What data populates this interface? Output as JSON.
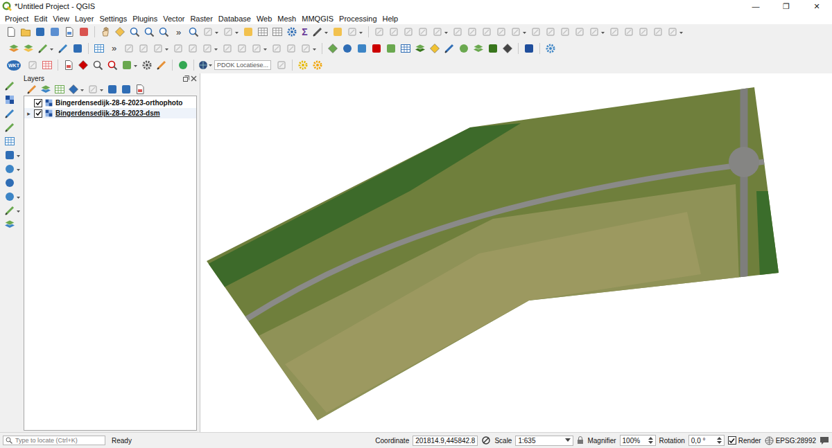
{
  "window": {
    "title": "*Untitled Project - QGIS",
    "controls": [
      "—",
      "❐",
      "✕"
    ]
  },
  "menu": [
    "Project",
    "Edit",
    "View",
    "Layer",
    "Settings",
    "Plugins",
    "Vector",
    "Raster",
    "Database",
    "Web",
    "Mesh",
    "MMQGIS",
    "Processing",
    "Help"
  ],
  "toolbars": {
    "overflow": "»",
    "statistics_symbol": "Σ",
    "wkt_button": "WKT",
    "locator_search": "PDOK Locatiese..."
  },
  "layers_panel": {
    "title": "Layers",
    "expand_arrow": "▸",
    "layers": [
      {
        "name": "Bingerdensedijk-28-6-2023-orthophoto",
        "visible": true,
        "expandable": false,
        "selected": false
      },
      {
        "name": "Bingerdensedijk-28-6-2023-dsm",
        "visible": true,
        "expandable": true,
        "selected": true
      }
    ]
  },
  "status_bar": {
    "locate_placeholder": "Type to locate (Ctrl+K)",
    "message": "Ready",
    "coordinate_label": "Coordinate",
    "coordinate": "201814.9,445842.8",
    "scale_label": "Scale",
    "scale": "1:635",
    "magnifier_label": "Magnifier",
    "magnifier": "100%",
    "rotation_label": "Rotation",
    "rotation": "0,0 °",
    "render_label": "Render",
    "render": true,
    "crs": "EPSG:28992"
  }
}
